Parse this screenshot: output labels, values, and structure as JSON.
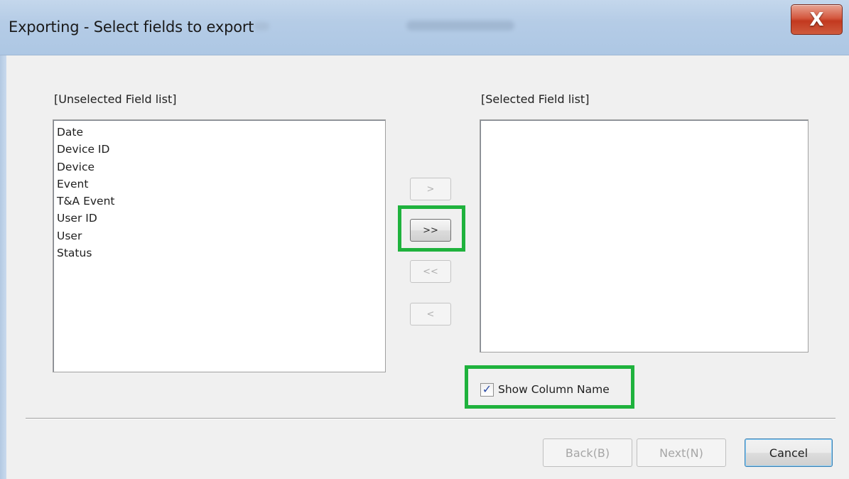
{
  "window": {
    "title": "Exporting - Select fields to export",
    "close_glyph": "X"
  },
  "unselected": {
    "label": "[Unselected Field list]",
    "items": [
      "Date",
      "Device ID",
      "Device",
      "Event",
      "T&A Event",
      "User ID",
      "User",
      "Status"
    ]
  },
  "selected": {
    "label": "[Selected Field list]",
    "items": []
  },
  "move_buttons": {
    "add": ">",
    "add_all": ">>",
    "remove_all": "<<",
    "remove": "<"
  },
  "show_column_name": {
    "label": "Show Column Name",
    "checked": true,
    "check_glyph": "✓"
  },
  "footer": {
    "back": "Back(B)",
    "next": "Next(N)",
    "cancel": "Cancel"
  },
  "colors": {
    "highlight": "#1fb23d",
    "titlebar": "#b5cce6",
    "close_button": "#c2391f",
    "dialog_bg": "#f0f0f0"
  }
}
